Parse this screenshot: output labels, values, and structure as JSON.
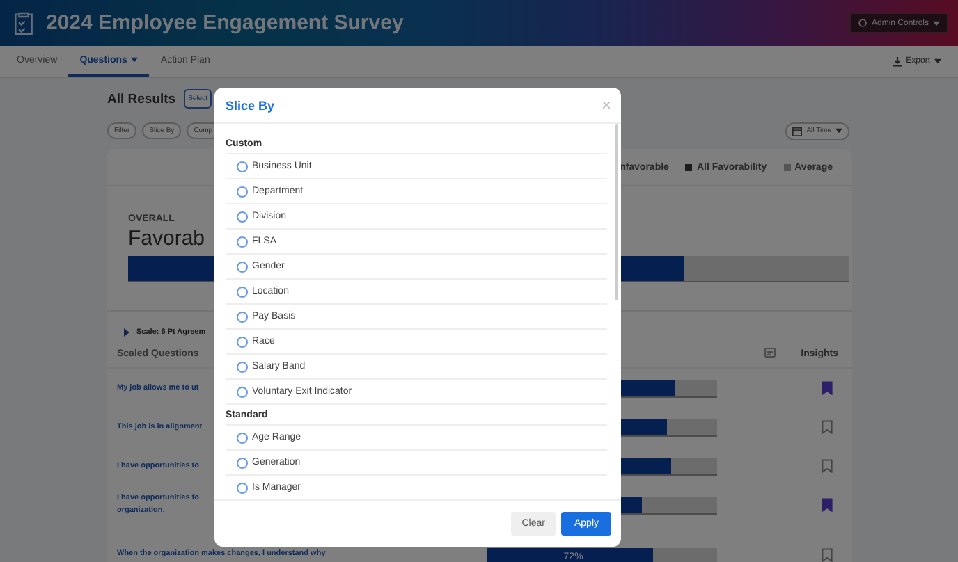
{
  "header": {
    "title": "2024 Employee Engagement Survey",
    "admin_button": "Admin Controls"
  },
  "nav": {
    "tabs": [
      {
        "label": "Overview",
        "selected": false
      },
      {
        "label": "Questions",
        "selected": true
      },
      {
        "label": "Action Plan",
        "selected": false
      }
    ],
    "export": "Export"
  },
  "results": {
    "title": "All Results",
    "select_button": "Select",
    "filters": [
      "Filter",
      "Slice By",
      "Comp"
    ],
    "date_button": "All Time",
    "legend": [
      {
        "label": "nfavorable"
      },
      {
        "label": "All Favorability",
        "kind": "dark"
      },
      {
        "label": "Average",
        "kind": "light"
      }
    ],
    "overall": {
      "label": "OVERALL",
      "title": "Favorab",
      "level": 0.77
    },
    "scale": {
      "label": "Scale: 6 Pt Agreem",
      "expanded": false
    },
    "columns": {
      "questions": "Scaled Questions",
      "insights": "Insights"
    },
    "rows": [
      {
        "lines": [
          "My job allows me to ut"
        ],
        "level": 0.82,
        "bookmarked": true
      },
      {
        "lines": [
          "This job is in alignment"
        ],
        "level": 0.78,
        "bookmarked": false
      },
      {
        "lines": [
          "I have opportunities to"
        ],
        "level": 0.8,
        "bookmarked": false
      },
      {
        "lines": [
          "I have opportunities fo",
          "organization."
        ],
        "level": 0.67,
        "bookmarked": true
      },
      {
        "lines": [
          "When the organization makes changes, I understand why"
        ],
        "level": 0.72,
        "percent": "72%",
        "bookmarked": false
      }
    ]
  },
  "modal": {
    "title": "Slice By",
    "sections": [
      {
        "heading": "Custom",
        "options": [
          {
            "label": "Business Unit",
            "selected": false
          },
          {
            "label": "Department",
            "selected": false
          },
          {
            "label": "Division",
            "selected": false
          },
          {
            "label": "FLSA",
            "selected": false
          },
          {
            "label": "Gender",
            "selected": false
          },
          {
            "label": "Location",
            "selected": false
          },
          {
            "label": "Pay Basis",
            "selected": false
          },
          {
            "label": "Race",
            "selected": false
          },
          {
            "label": "Salary Band",
            "selected": false
          },
          {
            "label": "Voluntary Exit Indicator",
            "selected": false
          }
        ]
      },
      {
        "heading": "Standard",
        "options": [
          {
            "label": "Age Range",
            "selected": false
          },
          {
            "label": "Generation",
            "selected": false
          },
          {
            "label": "Is Manager",
            "selected": false
          }
        ]
      }
    ],
    "clear": "Clear",
    "apply": "Apply"
  }
}
